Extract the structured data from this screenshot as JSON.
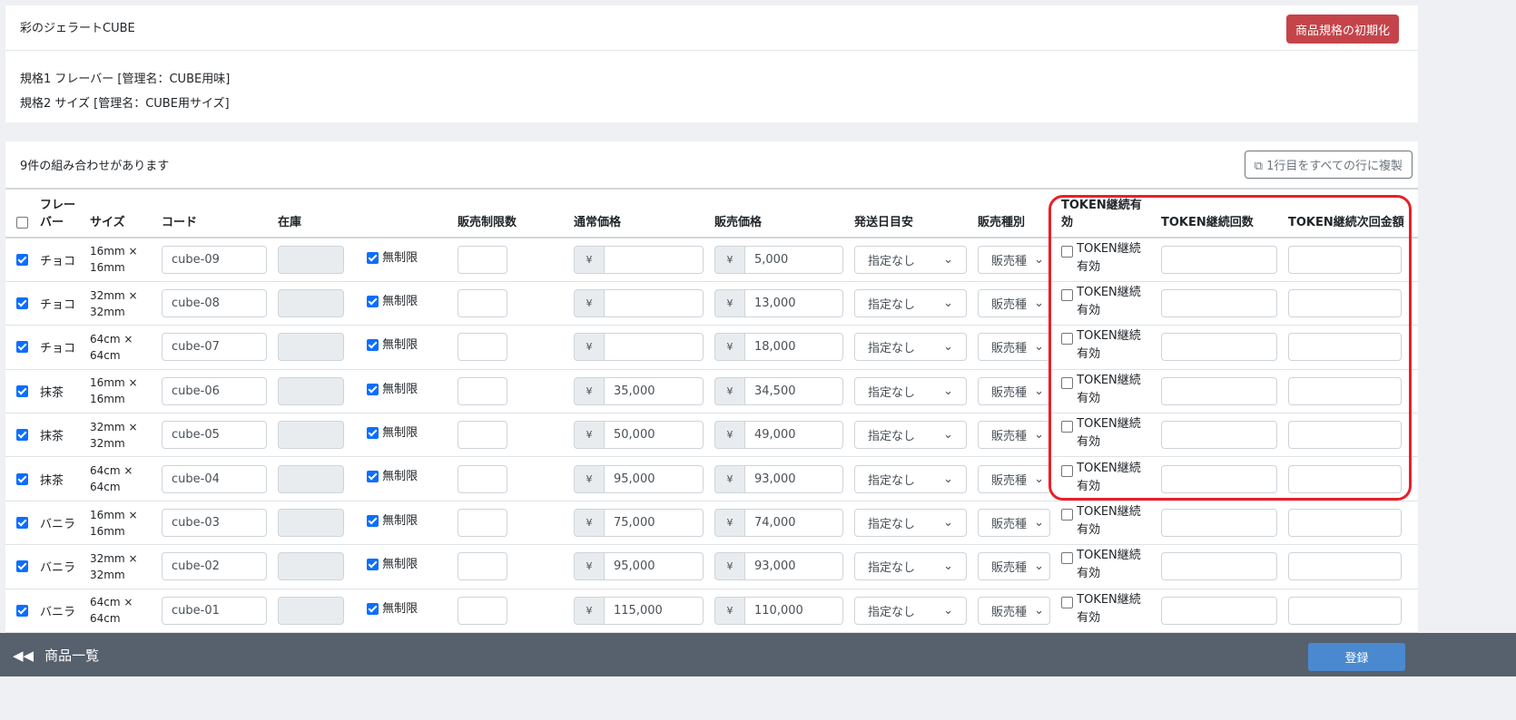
{
  "product": {
    "title": "彩のジェラートCUBE",
    "reset_label": "商品規格の初期化",
    "spec1": "規格1 フレーバー [管理名：CUBE用味]",
    "spec2": "規格2 サイズ [管理名：CUBE用サイズ]"
  },
  "combos": {
    "count_text": "9件の組み合わせがあります",
    "copy_label": "1行目をすべての行に複製"
  },
  "headers": [
    "フレーバー",
    "サイズ",
    "コード",
    "在庫",
    "",
    "販売制限数",
    "通常価格",
    "販売価格",
    "発送日目安",
    "販売種別",
    "TOKEN継続有効",
    "TOKEN継続回数",
    "TOKEN継続次回金額"
  ],
  "common": {
    "unlimited": "無制限",
    "yen": "¥",
    "ship": "指定なし",
    "type": "販売種",
    "token_label": "TOKEN継続有効"
  },
  "rows": [
    {
      "checked": true,
      "flavor": "チョコ",
      "size": "16mm × 16mm",
      "code": "cube-09",
      "normal": "",
      "sale": "5,000"
    },
    {
      "checked": true,
      "flavor": "チョコ",
      "size": "32mm × 32mm",
      "code": "cube-08",
      "normal": "",
      "sale": "13,000"
    },
    {
      "checked": true,
      "flavor": "チョコ",
      "size": "64cm × 64cm",
      "code": "cube-07",
      "normal": "",
      "sale": "18,000"
    },
    {
      "checked": true,
      "flavor": "抹茶",
      "size": "16mm × 16mm",
      "code": "cube-06",
      "normal": "35,000",
      "sale": "34,500"
    },
    {
      "checked": true,
      "flavor": "抹茶",
      "size": "32mm × 32mm",
      "code": "cube-05",
      "normal": "50,000",
      "sale": "49,000"
    },
    {
      "checked": true,
      "flavor": "抹茶",
      "size": "64cm × 64cm",
      "code": "cube-04",
      "normal": "95,000",
      "sale": "93,000"
    },
    {
      "checked": true,
      "flavor": "バニラ",
      "size": "16mm × 16mm",
      "code": "cube-03",
      "normal": "75,000",
      "sale": "74,000"
    },
    {
      "checked": true,
      "flavor": "バニラ",
      "size": "32mm × 32mm",
      "code": "cube-02",
      "normal": "95,000",
      "sale": "93,000"
    },
    {
      "checked": true,
      "flavor": "バニラ",
      "size": "64cm × 64cm",
      "code": "cube-01",
      "normal": "115,000",
      "sale": "110,000"
    }
  ],
  "footer": {
    "back_label": "商品一覧",
    "save_label": "登録"
  },
  "colors": {
    "highlight": "#e8202a",
    "accent": "#0d6efd",
    "danger": "#c4444a"
  }
}
